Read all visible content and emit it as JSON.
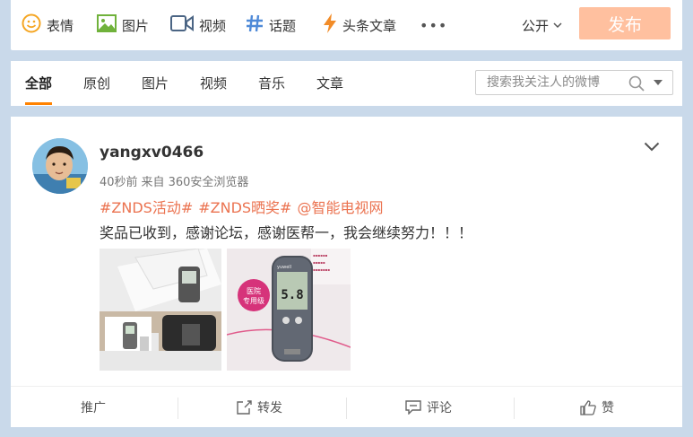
{
  "composer": {
    "tools": [
      {
        "label": "表情",
        "icon": "smiley-icon"
      },
      {
        "label": "图片",
        "icon": "image-icon"
      },
      {
        "label": "视频",
        "icon": "video-icon"
      },
      {
        "label": "话题",
        "icon": "hashtag-icon"
      },
      {
        "label": "头条文章",
        "icon": "lightning-icon"
      }
    ],
    "more": "•••",
    "visibility": "公开",
    "publish_label": "发布",
    "publish_color": "#ffc09f"
  },
  "tabs": {
    "items": [
      "全部",
      "原创",
      "图片",
      "视频",
      "音乐",
      "文章"
    ],
    "active": "全部",
    "accent": "#ff8200"
  },
  "search": {
    "placeholder": "搜索我关注人的微博"
  },
  "post": {
    "username": "yangxv0466",
    "time": "40秒前",
    "source_prefix": "来自",
    "source": "360安全浏览器",
    "tags": [
      "#ZNDS活动#",
      "#ZNDS晒奖#",
      "@智能电视网"
    ],
    "tag_color": "#eb7350",
    "text": "奖品已收到，感谢论坛，感谢医帮一，我会继续努力！！！",
    "images": [
      "photo-glucose-meter-kit",
      "photo-glucose-meter-closeup"
    ],
    "photo2_brand": "yuwell",
    "photo2_reading": "5.8",
    "photo2_badge": [
      "医院",
      "专用级"
    ]
  },
  "actions": {
    "promote": "推广",
    "forward": "转发",
    "comment": "评论",
    "like": "赞"
  }
}
